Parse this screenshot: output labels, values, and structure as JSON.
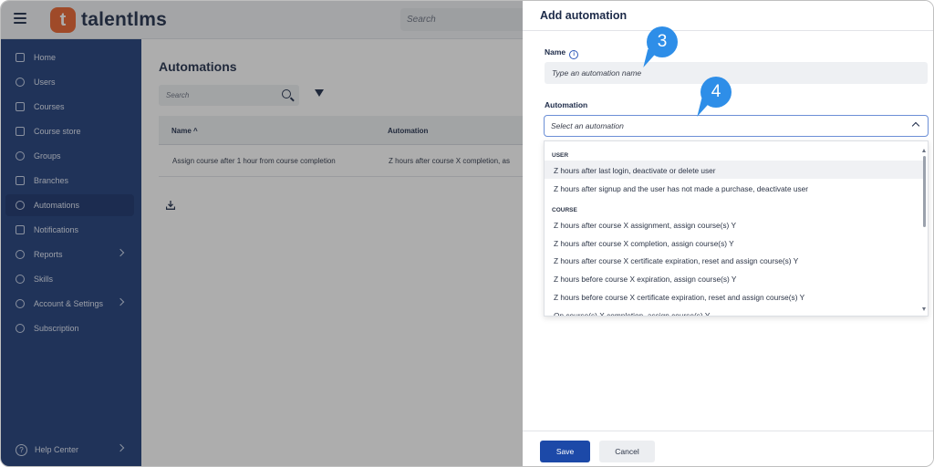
{
  "app": {
    "brand": "talentlms",
    "logo_letter": "t",
    "search_placeholder": "Search"
  },
  "sidebar": {
    "items": [
      {
        "label": "Home",
        "icon": "home-icon"
      },
      {
        "label": "Users",
        "icon": "user-icon"
      },
      {
        "label": "Courses",
        "icon": "book-icon"
      },
      {
        "label": "Course store",
        "icon": "store-icon"
      },
      {
        "label": "Groups",
        "icon": "groups-icon"
      },
      {
        "label": "Branches",
        "icon": "layers-icon"
      },
      {
        "label": "Automations",
        "icon": "automation-icon",
        "active": true
      },
      {
        "label": "Notifications",
        "icon": "megaphone-icon"
      },
      {
        "label": "Reports",
        "icon": "chart-icon",
        "has_submenu": true
      },
      {
        "label": "Skills",
        "icon": "skills-icon"
      },
      {
        "label": "Account & Settings",
        "icon": "gear-icon",
        "has_submenu": true
      },
      {
        "label": "Subscription",
        "icon": "subscription-icon"
      }
    ],
    "help": "Help Center"
  },
  "main": {
    "title": "Automations",
    "search_placeholder": "Search",
    "columns": {
      "name": "Name",
      "name_sort": "^",
      "automation": "Automation"
    },
    "rows": [
      {
        "name": "Assign course after 1 hour from course completion",
        "automation": "Z hours after course X completion, as"
      }
    ]
  },
  "drawer": {
    "title": "Add automation",
    "name_label": "Name",
    "name_placeholder": "Type an automation name",
    "automation_label": "Automation",
    "select_placeholder": "Select an automation",
    "groups": [
      {
        "label": "USER",
        "items": [
          "Z hours after last login, deactivate or delete user",
          "Z hours after signup and the user has not made a purchase, deactivate user"
        ]
      },
      {
        "label": "COURSE",
        "items": [
          "Z hours after course X assignment, assign course(s) Y",
          "Z hours after course X completion, assign course(s) Y",
          "Z hours after course X certificate expiration, reset and assign course(s) Y",
          "Z hours before course X expiration, assign course(s) Y",
          "Z hours before course X certificate expiration, reset and assign course(s) Y",
          "On course(s) X completion, assign course(s) Y"
        ]
      }
    ],
    "save": "Save",
    "cancel": "Cancel"
  },
  "callouts": {
    "step3": "3",
    "step4": "4"
  },
  "colors": {
    "sidebar": "#1c3b78",
    "primary": "#1c49a8",
    "brand_orange": "#e8602a",
    "callout": "#2e8ee8"
  }
}
